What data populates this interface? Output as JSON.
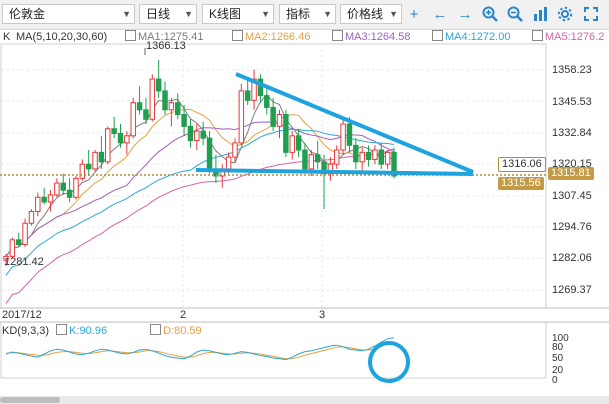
{
  "toolbar": {
    "symbol": "伦敦金",
    "period": "日线",
    "chart_type": "K线图",
    "indicator": "指标",
    "price_line": "价格线"
  },
  "legend": {
    "k": "K",
    "ma_params": "MA(5,10,20,30,60)",
    "ma1": "MA1:1275.41",
    "ma2": "MA2:1266.46",
    "ma3": "MA3:1264.58",
    "ma4": "MA4:1272.00",
    "ma5": "MA5:1276.2"
  },
  "y_axis": [
    "1358.23",
    "1345.53",
    "1332.84",
    "1320.15",
    "1307.45",
    "1294.76",
    "1282.06",
    "1269.37"
  ],
  "price_tags": {
    "upper": "1316.06",
    "current": "1315.81",
    "lower": "1315.56"
  },
  "annotations": {
    "high": "1366.13",
    "low": "1281.42"
  },
  "x_axis": [
    "2017/12",
    "2",
    "3"
  ],
  "kd": {
    "label": "KD(9,3,3)",
    "k": "K:90.96",
    "d": "D:80.59",
    "y_axis": [
      "100",
      "80",
      "50",
      "20",
      "0"
    ]
  },
  "colors": {
    "up": "#e8383a",
    "down": "#1f9f4f",
    "ma1": "#7b7b7b",
    "ma2": "#e6a23c",
    "ma3": "#a05fc0",
    "ma4": "#2aa7d6",
    "ma5": "#d663a8",
    "annotation": "#1fa3df",
    "priceline": "#b38b3a"
  },
  "chart_data": {
    "type": "candlestick",
    "ylim": [
      1262,
      1372
    ],
    "candles": [
      [
        1281.4,
        1284,
        1279,
        1283
      ],
      [
        1283,
        1291,
        1282,
        1290
      ],
      [
        1290,
        1293,
        1287,
        1288
      ],
      [
        1288,
        1299,
        1287,
        1297
      ],
      [
        1297,
        1303,
        1296,
        1302
      ],
      [
        1302,
        1310,
        1300,
        1308
      ],
      [
        1308,
        1312,
        1305,
        1306
      ],
      [
        1306,
        1311,
        1302,
        1309
      ],
      [
        1309,
        1316,
        1308,
        1314
      ],
      [
        1314,
        1318,
        1309,
        1311
      ],
      [
        1311,
        1316,
        1306,
        1308
      ],
      [
        1308,
        1317,
        1307,
        1316
      ],
      [
        1316,
        1324,
        1315,
        1322
      ],
      [
        1322,
        1328,
        1317,
        1320
      ],
      [
        1320,
        1328,
        1319,
        1327
      ],
      [
        1327,
        1334,
        1320,
        1323
      ],
      [
        1323,
        1338,
        1322,
        1337
      ],
      [
        1337,
        1342,
        1333,
        1335
      ],
      [
        1335,
        1339,
        1329,
        1331
      ],
      [
        1331,
        1336,
        1326,
        1334
      ],
      [
        1334,
        1350,
        1333,
        1348
      ],
      [
        1348,
        1355,
        1343,
        1345
      ],
      [
        1345,
        1350,
        1339,
        1341
      ],
      [
        1341,
        1360,
        1340,
        1358
      ],
      [
        1358,
        1366.13,
        1350,
        1353
      ],
      [
        1353,
        1357,
        1343,
        1345
      ],
      [
        1345,
        1350,
        1338,
        1348
      ],
      [
        1348,
        1352,
        1341,
        1343
      ],
      [
        1343,
        1347,
        1334,
        1338
      ],
      [
        1338,
        1341,
        1329,
        1332
      ],
      [
        1332,
        1339,
        1328,
        1336
      ],
      [
        1336,
        1340,
        1330,
        1333
      ],
      [
        1333,
        1336,
        1318,
        1320
      ],
      [
        1320,
        1326,
        1314,
        1317
      ],
      [
        1317,
        1322,
        1312,
        1320
      ],
      [
        1320,
        1327,
        1318,
        1325
      ],
      [
        1325,
        1333,
        1323,
        1331
      ],
      [
        1331,
        1356,
        1330,
        1353
      ],
      [
        1353,
        1359,
        1347,
        1349
      ],
      [
        1349,
        1362,
        1345,
        1358
      ],
      [
        1358,
        1360,
        1348,
        1351
      ],
      [
        1351,
        1355,
        1343,
        1346
      ],
      [
        1346,
        1350,
        1336,
        1338
      ],
      [
        1338,
        1345,
        1333,
        1343
      ],
      [
        1343,
        1345,
        1325,
        1327
      ],
      [
        1327,
        1336,
        1324,
        1334
      ],
      [
        1334,
        1337,
        1325,
        1328
      ],
      [
        1328,
        1331,
        1318,
        1320
      ],
      [
        1320,
        1328,
        1317,
        1326
      ],
      [
        1326,
        1332,
        1320,
        1323
      ],
      [
        1323,
        1326,
        1303,
        1318
      ],
      [
        1318,
        1325,
        1315,
        1322
      ],
      [
        1322,
        1330,
        1320,
        1328
      ],
      [
        1328,
        1341,
        1326,
        1339
      ],
      [
        1339,
        1342,
        1327,
        1330
      ],
      [
        1330,
        1333,
        1320,
        1323
      ],
      [
        1323,
        1329,
        1318,
        1327
      ],
      [
        1327,
        1330,
        1321,
        1324
      ],
      [
        1324,
        1330,
        1322,
        1328
      ],
      [
        1328,
        1331,
        1320,
        1322
      ],
      [
        1322,
        1328,
        1320,
        1327
      ],
      [
        1327,
        1329,
        1316,
        1317
      ]
    ],
    "kd_k": [
      50,
      55,
      52,
      48,
      45,
      42,
      50,
      58,
      62,
      60,
      55,
      50,
      48,
      52,
      58,
      62,
      60,
      56,
      52,
      50,
      54,
      60,
      62,
      58,
      52,
      46,
      42,
      40,
      38,
      45,
      55,
      60,
      58,
      54,
      50,
      48,
      52,
      56,
      54,
      50,
      46,
      44,
      40,
      38,
      36,
      42,
      50,
      56,
      58,
      62,
      66,
      70,
      72,
      68,
      62,
      60,
      58,
      62,
      70,
      80,
      88,
      90.96
    ],
    "kd_d": [
      52,
      53,
      53,
      51,
      49,
      47,
      47,
      50,
      54,
      56,
      56,
      54,
      52,
      51,
      53,
      56,
      58,
      57,
      55,
      53,
      53,
      55,
      58,
      58,
      56,
      52,
      48,
      45,
      42,
      42,
      46,
      51,
      54,
      54,
      52,
      50,
      50,
      52,
      53,
      52,
      50,
      47,
      44,
      41,
      38,
      38,
      42,
      47,
      51,
      55,
      59,
      63,
      67,
      68,
      66,
      63,
      60,
      60,
      63,
      69,
      75,
      80.59
    ]
  }
}
